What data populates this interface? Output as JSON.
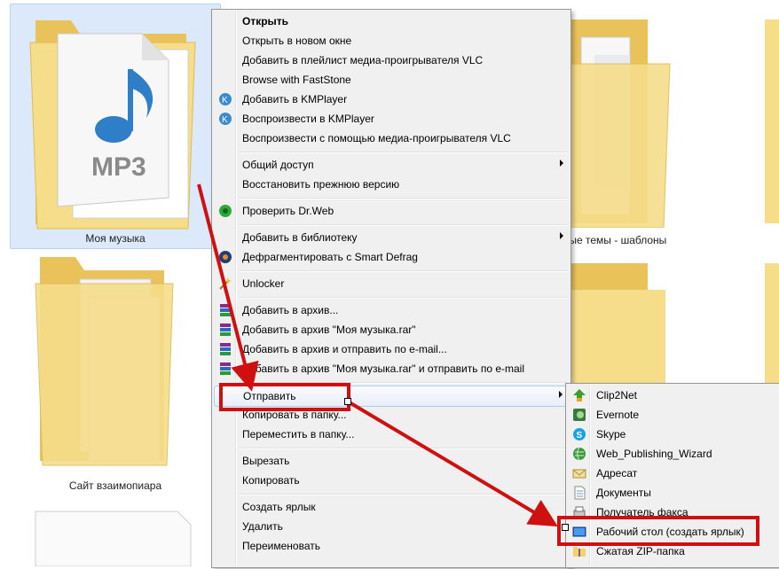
{
  "folders": {
    "music": {
      "label": "Моя музыка",
      "badge": "MP3"
    },
    "second": {
      "label": "Сайт взаимопиара"
    },
    "right": {
      "label": "вые темы - шаблоны"
    }
  },
  "context_menu": {
    "items": [
      {
        "label": "Открыть",
        "bold": true
      },
      {
        "label": "Открыть в новом окне"
      },
      {
        "label": "Добавить в плейлист медиа-проигрывателя VLC"
      },
      {
        "label": "Browse with FastStone"
      },
      {
        "label": "Добавить в KMPlayer"
      },
      {
        "label": "Воспроизвести в KMPlayer"
      },
      {
        "label": "Воспроизвести с помощью медиа-проигрывателя VLC"
      },
      {
        "label": "Общий доступ"
      },
      {
        "label": "Восстановить прежнюю версию"
      },
      {
        "label": "Проверить Dr.Web"
      },
      {
        "label": "Добавить в библиотеку"
      },
      {
        "label": "Дефрагментировать с Smart Defrag"
      },
      {
        "label": "Unlocker"
      },
      {
        "label": "Добавить в архив..."
      },
      {
        "label": "Добавить в архив \"Моя музыка.rar\""
      },
      {
        "label": "Добавить в архив и отправить по e-mail..."
      },
      {
        "label": "Добавить в архив \"Моя музыка.rar\" и отправить по e-mail"
      },
      {
        "label": "Отправить"
      },
      {
        "label": "Копировать в папку..."
      },
      {
        "label": "Переместить в папку..."
      },
      {
        "label": "Вырезать"
      },
      {
        "label": "Копировать"
      },
      {
        "label": "Создать ярлык"
      },
      {
        "label": "Удалить"
      },
      {
        "label": "Переименовать"
      }
    ]
  },
  "send_to_menu": {
    "items": [
      {
        "label": "Clip2Net"
      },
      {
        "label": "Evernote"
      },
      {
        "label": "Skype"
      },
      {
        "label": "Web_Publishing_Wizard"
      },
      {
        "label": "Адресат"
      },
      {
        "label": "Документы"
      },
      {
        "label": "Получатель факса"
      },
      {
        "label": "Рабочий стол (создать ярлык)"
      },
      {
        "label": "Сжатая ZIP-папка"
      }
    ]
  },
  "colors": {
    "annotation": "#d01010",
    "folder": "#f5d97a",
    "highlight": "#aeccf0"
  }
}
